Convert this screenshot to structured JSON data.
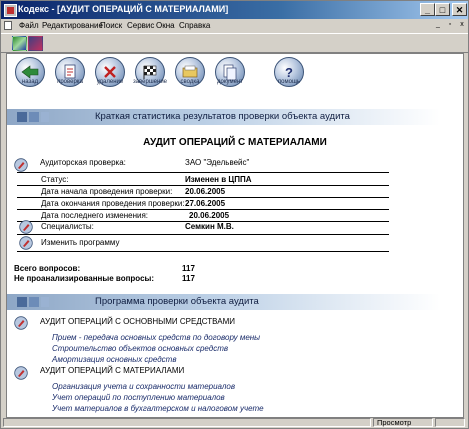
{
  "window": {
    "title": "Кодекс - [АУДИТ ОПЕРАЦИЙ С МАТЕРИАЛАМИ]",
    "controls": {
      "minimize": "_",
      "maximize": "□",
      "close": "✕"
    }
  },
  "menu": [
    {
      "label": "Файл"
    },
    {
      "label": "Редактирование"
    },
    {
      "label": "Поиск"
    },
    {
      "label": "Сервис"
    },
    {
      "label": "Окна"
    },
    {
      "label": "Справка"
    }
  ],
  "nav_buttons": [
    {
      "label": "назад",
      "icon": "back-arrow-icon"
    },
    {
      "label": "проверка",
      "icon": "checklist-icon"
    },
    {
      "label": "удаление",
      "icon": "delete-x-icon"
    },
    {
      "label": "завершение",
      "icon": "finish-flag-icon"
    },
    {
      "label": "сводка",
      "icon": "summary-folder-icon"
    },
    {
      "label": "документ",
      "icon": "document-icon"
    },
    {
      "label": "помощь",
      "icon": "help-question-icon"
    }
  ],
  "section1": {
    "title": "Краткая статистика результатов проверки объекта аудита"
  },
  "heading": "АУДИТ ОПЕРАЦИЙ С МАТЕРИАЛАМИ",
  "audit": {
    "label": "Аудиторская проверка:",
    "value": "ЗАО \"Эдельвейс\""
  },
  "fields": [
    {
      "label": "Статус:",
      "value": "Изменен в ЦППА"
    },
    {
      "label": "Дата начала проведения  проверки:",
      "value": "20.06.2005"
    },
    {
      "label": "Дата окончания проведения проверки:",
      "value": "27.06.2005"
    },
    {
      "label": "Дата последнего изменения:",
      "value": "20.06.2005"
    }
  ],
  "specialists": {
    "label": "Специалисты:",
    "value": "Семкин М.В."
  },
  "change_program": "Изменить программу",
  "totals": [
    {
      "label": "Всего вопросов:",
      "value": "117"
    },
    {
      "label": "Не проанализированные вопросы:",
      "value": "117"
    }
  ],
  "section2": {
    "title": "Программа проверки объекта аудита"
  },
  "program": [
    {
      "title": "АУДИТ ОПЕРАЦИЙ С ОСНОВНЫМИ СРЕДСТВАМИ",
      "items": [
        "Прием - передача основных средств по договору мены",
        "Строительство объектов основных средств",
        "Амортизация основных средств"
      ]
    },
    {
      "title": "АУДИТ ОПЕРАЦИЙ С МАТЕРИАЛАМИ",
      "items": [
        "Организация учета и сохранности материалов",
        "Учет операций по поступлению материалов",
        "Учет материалов в бухгалтерском и налоговом учете"
      ]
    }
  ],
  "statusbar": {
    "mode": "Просмотр"
  },
  "colors": {
    "title_start": "#0a246a",
    "title_end": "#a6caf0",
    "banner": "#8ea7c6",
    "link": "#1a2c6a"
  }
}
